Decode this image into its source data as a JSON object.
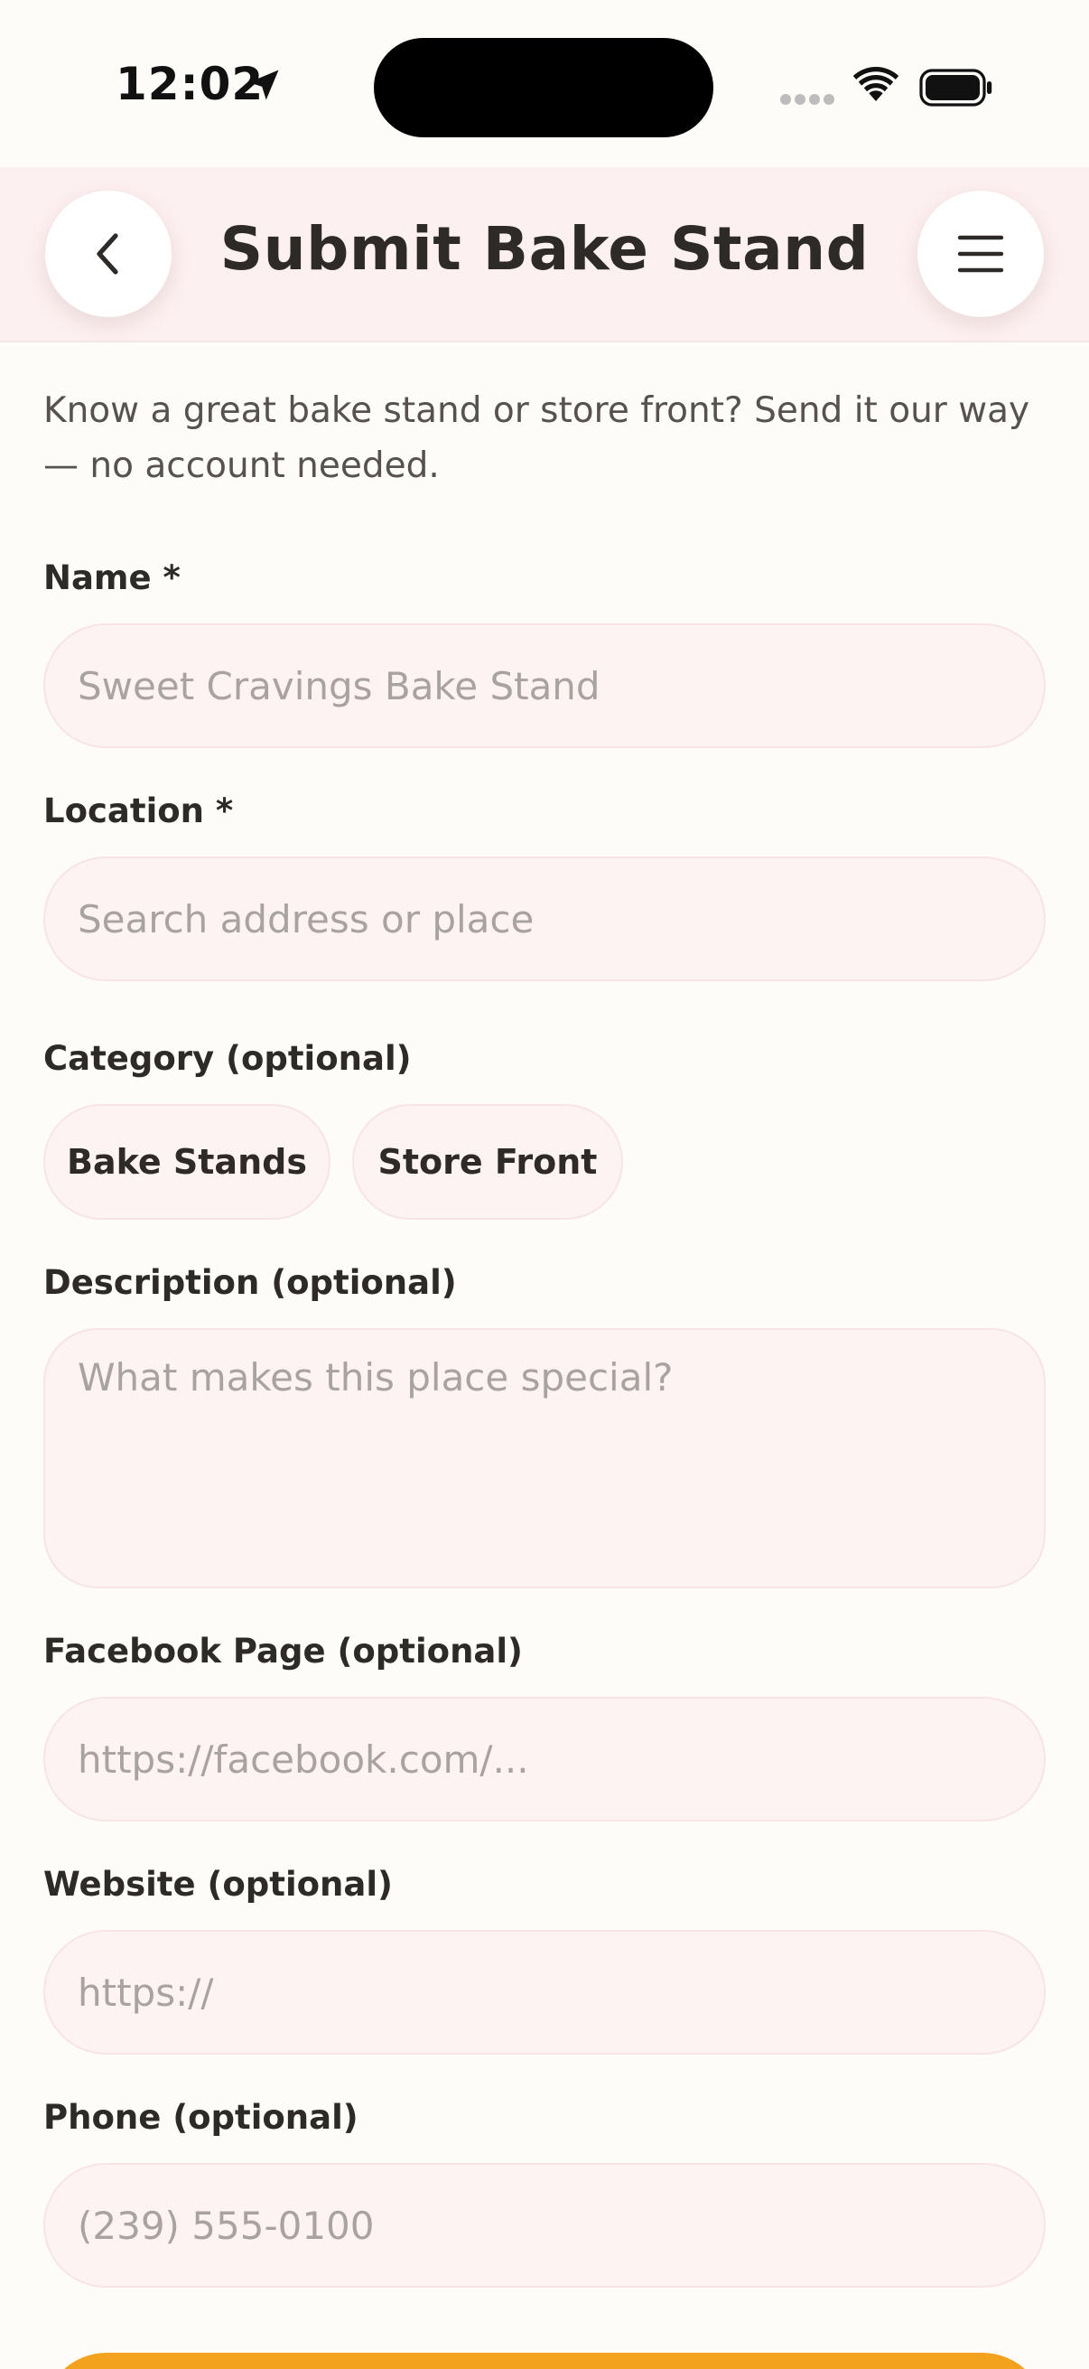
{
  "status_bar": {
    "time": "12:02"
  },
  "header": {
    "title": "Submit Bake Stand",
    "back_icon": "chevron-left-icon",
    "menu_icon": "hamburger-menu-icon"
  },
  "intro_text": "Know a great bake stand or store front? Send it our way — no account needed.",
  "form": {
    "name": {
      "label": "Name *",
      "value": "",
      "placeholder": "Sweet Cravings Bake Stand"
    },
    "location": {
      "label": "Location *",
      "value": "",
      "placeholder": "Search address or place"
    },
    "category": {
      "label": "Category (optional)",
      "options": [
        "Bake Stands",
        "Store Front"
      ]
    },
    "description": {
      "label": "Description (optional)",
      "value": "",
      "placeholder": "What makes this place special?"
    },
    "facebook": {
      "label": "Facebook Page (optional)",
      "value": "",
      "placeholder": "https://facebook.com/..."
    },
    "website": {
      "label": "Website (optional)",
      "value": "",
      "placeholder": "https://"
    },
    "phone": {
      "label": "Phone (optional)",
      "value": "",
      "placeholder": "(239) 555-0100"
    }
  },
  "colors": {
    "background": "#fdfcf8",
    "header_background": "#fdf0f0",
    "field_background": "#fef3f3",
    "accent": "#f3a21d",
    "text": "#2d2a28"
  }
}
